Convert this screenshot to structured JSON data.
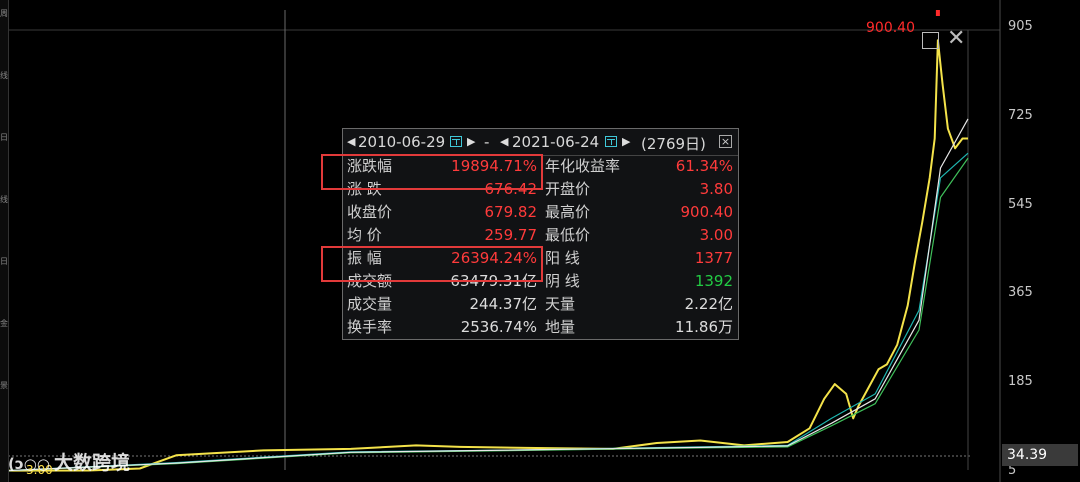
{
  "chart_data": {
    "type": "line",
    "y_axis_ticks": [
      "905",
      "725",
      "545",
      "365",
      "185",
      "5"
    ],
    "ylim": [
      5,
      905
    ],
    "xlim": [
      "2010-06-29",
      "2021-06-24"
    ],
    "last_price": "34.39",
    "max_marker": "900.40",
    "min_marker": "3.00",
    "series": [
      {
        "color": "#f4e34a",
        "x": [
          "2010-06-29",
          "2011-06-01",
          "2012-01-01",
          "2012-06-01",
          "2013-06-01",
          "2014-06-01",
          "2015-03-01",
          "2015-09-01",
          "2016-06-01",
          "2017-06-01",
          "2017-12-01",
          "2018-06-01",
          "2018-12-01",
          "2019-06-01",
          "2019-09-01",
          "2019-11-01",
          "2019-12-15",
          "2020-02-01",
          "2020-03-01",
          "2020-03-23",
          "2020-05-01",
          "2020-06-15",
          "2020-07-20",
          "2020-09-01",
          "2020-10-15",
          "2020-11-15",
          "2020-12-15",
          "2021-01-15",
          "2021-02-05",
          "2021-02-18",
          "2021-03-10",
          "2021-04-01",
          "2021-05-01",
          "2021-06-01",
          "2021-06-24"
        ],
        "y": [
          3.8,
          4,
          8,
          35,
          45,
          48,
          55,
          52,
          50,
          48,
          60,
          65,
          55,
          62,
          90,
          150,
          180,
          160,
          110,
          135,
          170,
          210,
          220,
          260,
          340,
          430,
          510,
          600,
          680,
          880,
          790,
          700,
          660,
          680,
          680
        ]
      },
      {
        "color": "#1fb5b0",
        "x": [
          "2010-06-29",
          "2012-06-01",
          "2014-06-01",
          "2016-06-01",
          "2018-06-01",
          "2019-06-01",
          "2019-12-01",
          "2020-06-01",
          "2020-12-01",
          "2021-03-01",
          "2021-06-24"
        ],
        "y": [
          3.8,
          20,
          42,
          46,
          52,
          55,
          110,
          160,
          330,
          600,
          650
        ]
      },
      {
        "color": "#3fbf5a",
        "x": [
          "2010-06-29",
          "2012-06-01",
          "2014-06-01",
          "2016-06-01",
          "2018-06-01",
          "2019-06-01",
          "2019-12-01",
          "2020-06-01",
          "2020-12-01",
          "2021-03-01",
          "2021-06-24"
        ],
        "y": [
          3.8,
          18,
          40,
          45,
          50,
          52,
          95,
          140,
          290,
          560,
          640
        ]
      },
      {
        "color": "#e8e8e8",
        "x": [
          "2010-06-29",
          "2012-06-01",
          "2014-06-01",
          "2016-06-01",
          "2018-06-01",
          "2019-06-01",
          "2019-12-01",
          "2020-06-01",
          "2020-12-01",
          "2021-03-01",
          "2021-06-24"
        ],
        "y": [
          3.8,
          19,
          41,
          46,
          51,
          54,
          100,
          150,
          310,
          620,
          720
        ]
      }
    ]
  },
  "stats": {
    "start_date": "2010-06-29",
    "dash": "-",
    "end_date": "2021-06-24",
    "days": "(2769日)",
    "close_glyph": "×",
    "left_rows": [
      {
        "label": "涨跌幅",
        "value": "19894.71%",
        "color": "red"
      },
      {
        "label": "涨  跌",
        "value": "676.42",
        "color": "red"
      },
      {
        "label": "收盘价",
        "value": "679.82",
        "color": "red"
      },
      {
        "label": "均  价",
        "value": "259.77",
        "color": "red"
      },
      {
        "label": "振  幅",
        "value": "26394.24%",
        "color": "red"
      },
      {
        "label": "成交额",
        "value": "63479.31亿",
        "color": "white"
      },
      {
        "label": "成交量",
        "value": "244.37亿",
        "color": "white"
      },
      {
        "label": "换手率",
        "value": "2536.74%",
        "color": "white"
      }
    ],
    "right_rows": [
      {
        "label": "年化收益率",
        "value": "61.34%",
        "color": "red"
      },
      {
        "label": "开盘价",
        "value": "3.80",
        "color": "red"
      },
      {
        "label": "最高价",
        "value": "900.40",
        "color": "red"
      },
      {
        "label": "最低价",
        "value": "3.00",
        "color": "red"
      },
      {
        "label": "阳  线",
        "value": "1377",
        "color": "red"
      },
      {
        "label": "阴  线",
        "value": "1392",
        "color": "green"
      },
      {
        "label": "天量",
        "value": "2.22亿",
        "color": "white"
      },
      {
        "label": "地量",
        "value": "11.86万",
        "color": "white"
      }
    ]
  },
  "watermark": "大数跨境",
  "left_strip_glyphs": [
    "周",
    "线",
    "日",
    "线",
    "日",
    "金",
    "景"
  ]
}
